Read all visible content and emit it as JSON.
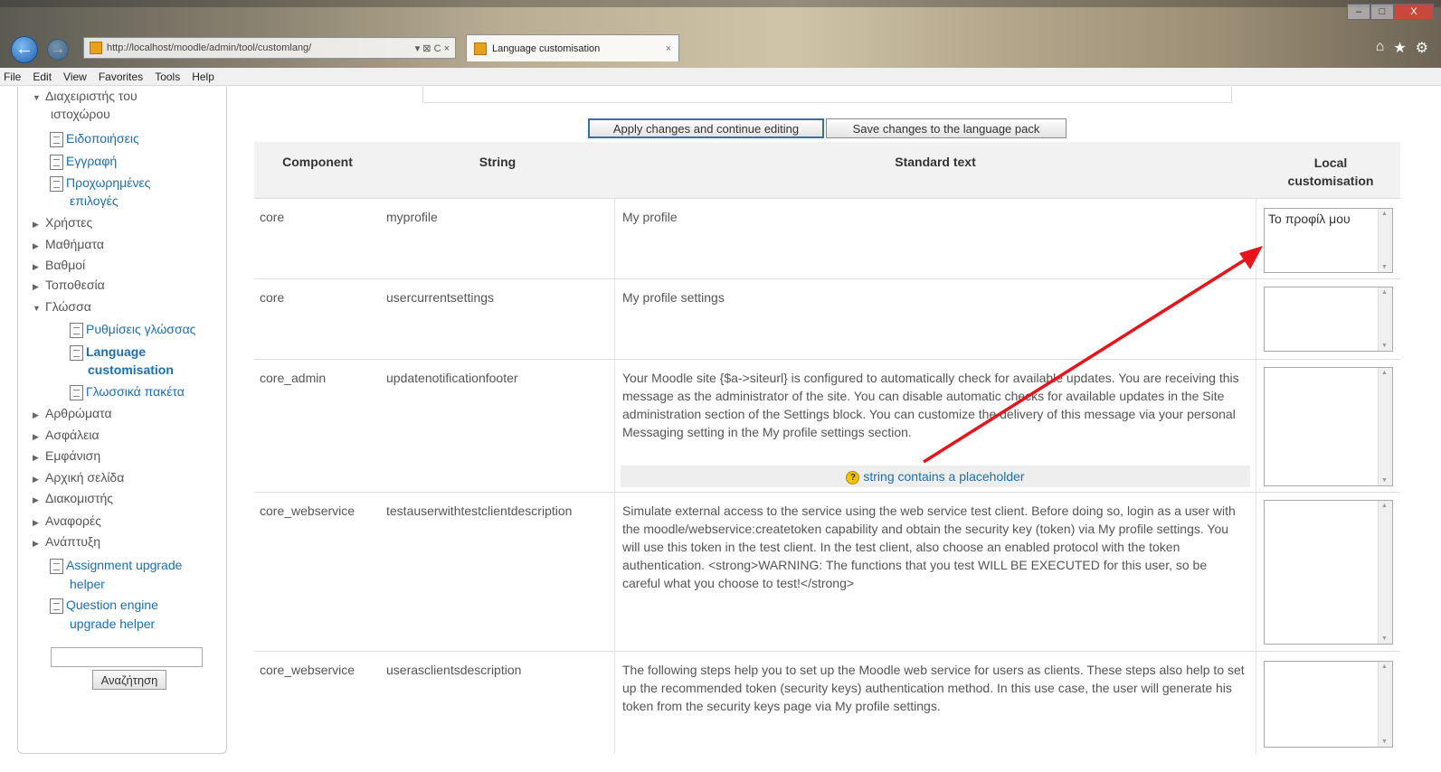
{
  "browser": {
    "url": "http://localhost/moodle/admin/tool/customlang/",
    "tab_title": "Language customisation",
    "tab_close": "×",
    "back_glyph": "←",
    "forward_glyph": "→",
    "addr_controls": "▾ ⊠ C ×",
    "window_min": "–",
    "window_max": "□",
    "window_close": "X",
    "home_icon": "⌂",
    "star_icon": "★",
    "gear_icon": "⚙"
  },
  "menubar": [
    "File",
    "Edit",
    "View",
    "Favorites",
    "Tools",
    "Help"
  ],
  "sidebar": {
    "items": [
      {
        "label": "Διαχειριστής του",
        "type": "expanded"
      },
      {
        "label": "ιστοχώρου",
        "type": "cont"
      },
      {
        "label": "Ειδοποιήσεις",
        "type": "page"
      },
      {
        "label": "Εγγραφή",
        "type": "page"
      },
      {
        "label": "Προχωρημένες",
        "type": "page"
      },
      {
        "label": "επιλογές",
        "type": "cont-link"
      },
      {
        "label": "Χρήστες",
        "type": "collapsed"
      },
      {
        "label": "Μαθήματα",
        "type": "collapsed"
      },
      {
        "label": "Βαθμοί",
        "type": "collapsed"
      },
      {
        "label": "Τοποθεσία",
        "type": "collapsed"
      },
      {
        "label": "Γλώσσα",
        "type": "expanded"
      },
      {
        "label": "Ρυθμίσεις γλώσσας",
        "type": "subpage"
      },
      {
        "label": "Language",
        "type": "subpage-active"
      },
      {
        "label": "customisation",
        "type": "cont-active"
      },
      {
        "label": "Γλωσσικά πακέτα",
        "type": "subpage"
      },
      {
        "label": "Αρθρώματα",
        "type": "collapsed"
      },
      {
        "label": "Ασφάλεια",
        "type": "collapsed"
      },
      {
        "label": "Εμφάνιση",
        "type": "collapsed"
      },
      {
        "label": "Αρχική σελίδα",
        "type": "collapsed"
      },
      {
        "label": "Διακομιστής",
        "type": "collapsed"
      },
      {
        "label": "Αναφορές",
        "type": "collapsed"
      },
      {
        "label": "Ανάπτυξη",
        "type": "collapsed"
      },
      {
        "label": "Assignment upgrade",
        "type": "page"
      },
      {
        "label": "helper",
        "type": "cont-link"
      },
      {
        "label": "Question engine",
        "type": "page"
      },
      {
        "label": "upgrade helper",
        "type": "cont-link"
      }
    ],
    "search_value": "",
    "search_button": "Αναζήτηση"
  },
  "actions": {
    "apply": "Apply changes and continue editing",
    "save": "Save changes to the language pack"
  },
  "table": {
    "headers": {
      "component": "Component",
      "string": "String",
      "standard": "Standard text",
      "local_line1": "Local",
      "local_line2": "customisation"
    },
    "rows": [
      {
        "component": "core",
        "string": "myprofile",
        "standard": "My profile",
        "local": "Το προφίλ μου",
        "placeholder": ""
      },
      {
        "component": "core",
        "string": "usercurrentsettings",
        "standard": "My profile settings",
        "local": "",
        "placeholder": ""
      },
      {
        "component": "core_admin",
        "string": "updatenotificationfooter",
        "standard": "Your Moodle site {$a->siteurl} is configured to automatically check for available updates. You are receiving this message as the administrator of the site. You can disable automatic checks for available updates in the Site administration section of the Settings block. You can customize the delivery of this message via your personal Messaging setting in the My profile settings section.",
        "local": "",
        "placeholder": "string contains a placeholder"
      },
      {
        "component": "core_webservice",
        "string": "testauserwithtestclientdescription",
        "standard": "Simulate external access to the service using the web service test client. Before doing so, login as a user with the moodle/webservice:createtoken capability and obtain the security key (token) via My profile settings. You will use this token in the test client. In the test client, also choose an enabled protocol with the token authentication. <strong>WARNING: The functions that you test WILL BE EXECUTED for this user, so be careful what you choose to test!</strong>",
        "local": "",
        "placeholder": ""
      },
      {
        "component": "core_webservice",
        "string": "userasclientsdescription",
        "standard": "The following steps help you to set up the Moodle web service for users as clients. These steps also help to set up the recommended token (security keys) authentication method. In this use case, the user will generate his token from the security keys page via My profile settings.",
        "local": "",
        "placeholder": ""
      }
    ]
  },
  "colors": {
    "link": "#1a6fb0",
    "annotation_arrow": "#e8141c",
    "header_bg": "#f2f2f2"
  }
}
